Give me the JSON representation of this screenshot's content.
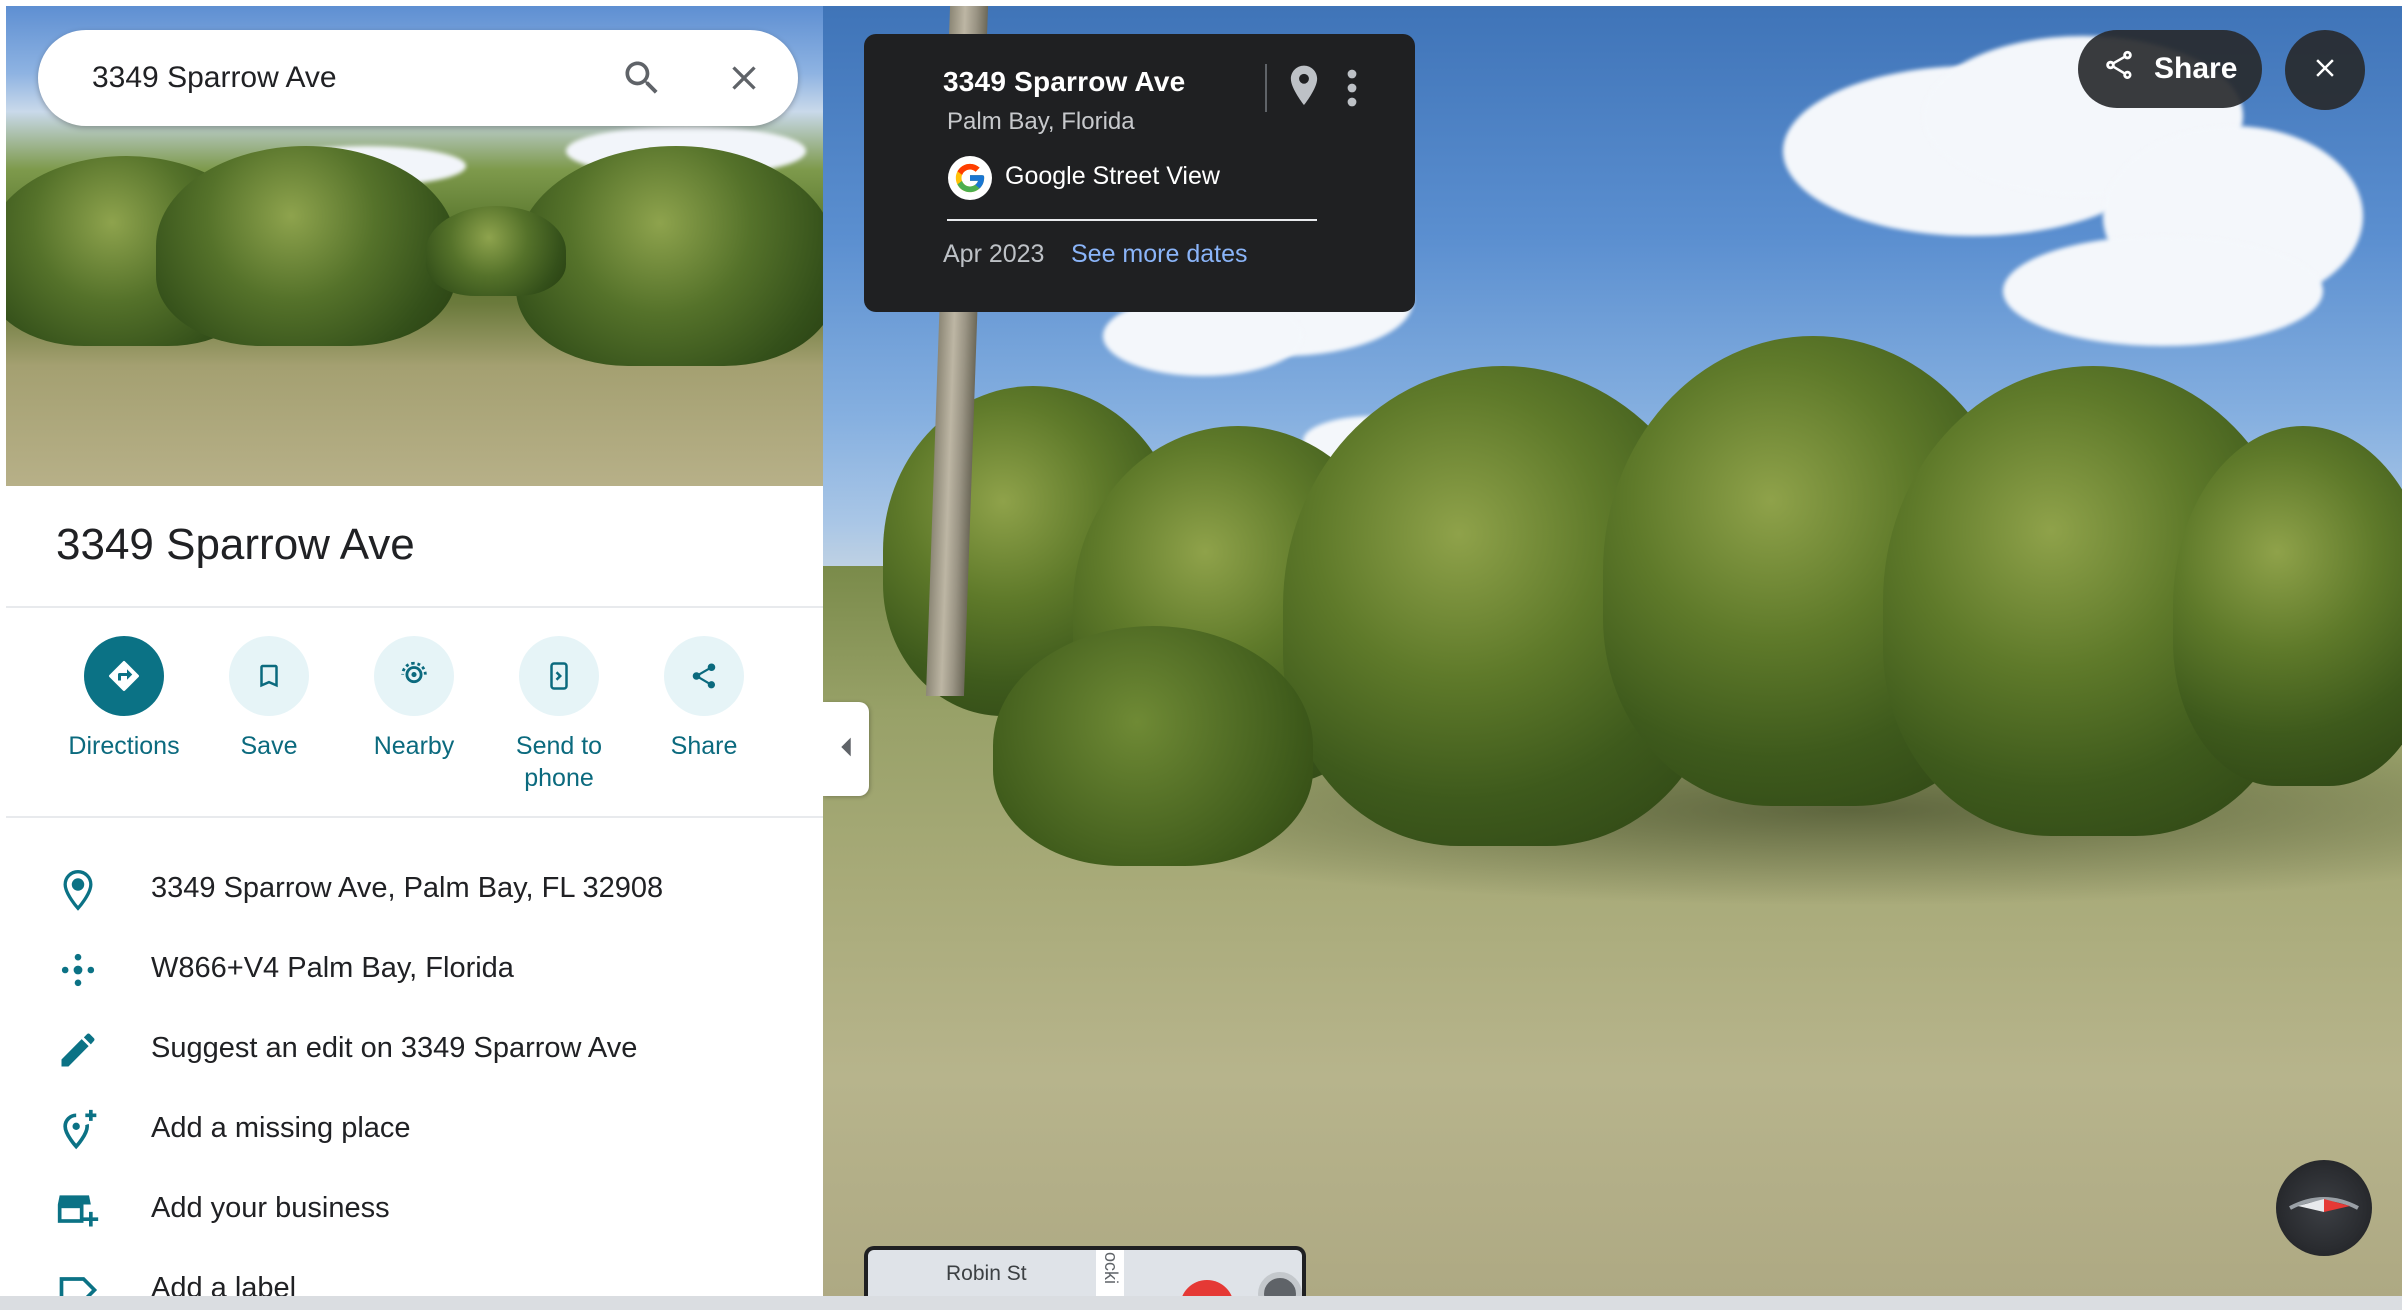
{
  "search": {
    "value": "3349 Sparrow Ave"
  },
  "place": {
    "title": "3349 Sparrow Ave"
  },
  "actions": [
    {
      "label": "Directions",
      "icon": "directions-icon"
    },
    {
      "label": "Save",
      "icon": "bookmark-icon"
    },
    {
      "label": "Nearby",
      "icon": "nearby-icon"
    },
    {
      "label": "Send to\nphone",
      "icon": "send-to-phone-icon"
    },
    {
      "label": "Share",
      "icon": "share-icon"
    }
  ],
  "details": [
    {
      "text": "3349 Sparrow Ave, Palm Bay, FL 32908",
      "icon": "location-pin-icon"
    },
    {
      "text": "W866+V4 Palm Bay, Florida",
      "icon": "plus-code-icon"
    },
    {
      "text": "Suggest an edit on 3349 Sparrow Ave",
      "icon": "pencil-icon"
    },
    {
      "text": "Add a missing place",
      "icon": "add-location-icon"
    },
    {
      "text": "Add your business",
      "icon": "add-business-icon"
    },
    {
      "text": "Add a label",
      "icon": "label-icon"
    }
  ],
  "streetview": {
    "title": "3349 Sparrow Ave",
    "subtitle": "Palm Bay, Florida",
    "provider": "Google Street View",
    "date": "Apr 2023",
    "more_dates": "See more dates",
    "share_label": "Share"
  },
  "minimap": {
    "street": "Robin St",
    "side_street": "ocki"
  },
  "colors": {
    "accent": "#0b7285",
    "link": "#8ab4f8",
    "card_bg": "#1f2022"
  }
}
